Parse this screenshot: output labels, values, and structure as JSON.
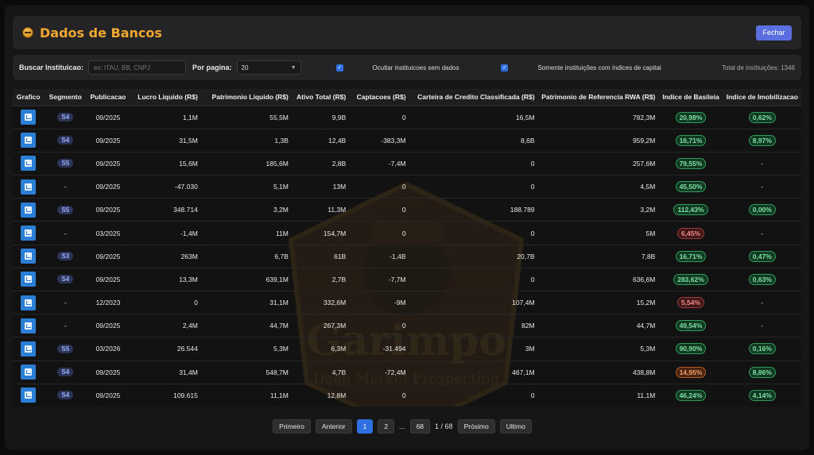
{
  "header": {
    "title": "Dados de Bancos",
    "close_label": "Fechar"
  },
  "filters": {
    "search_label": "Buscar Instituicao:",
    "search_placeholder": "ex: ITAU, BB, CNPJ",
    "per_page_label": "Por pagina:",
    "per_page_value": "20",
    "hide_no_data_label": "Ocultar instituicoes sem dados",
    "hide_no_data_checked": true,
    "only_capital_label": "Somente instituições com índices de capital",
    "only_capital_checked": true,
    "total_label": "Total de instituições: 1346"
  },
  "table": {
    "columns": [
      "Grafico",
      "Segmento",
      "Publicacao",
      "Lucro Liquido (R$)",
      "Patrimonio Liquido (R$)",
      "Ativo Total (R$)",
      "Captacoes (R$)",
      "Carteira de Credito Classificada (R$)",
      "Patrimonio de Referencia RWA (R$)",
      "Indice de Basileia",
      "Indice de Imobilizacao"
    ],
    "rows": [
      {
        "segmento": "S4",
        "publicacao": "09/2025",
        "lucro": "1,1M",
        "patrimonio": "55,5M",
        "ativo": "9,9B",
        "captacoes": "0",
        "carteira": "16,5M",
        "pr_rwa": "782,3M",
        "basileia": "20,98%",
        "basileia_status": "green",
        "imobilizacao": "0,62%"
      },
      {
        "segmento": "S4",
        "publicacao": "09/2025",
        "lucro": "31,5M",
        "patrimonio": "1,3B",
        "ativo": "12,4B",
        "captacoes": "-383,3M",
        "carteira": "8,6B",
        "pr_rwa": "959,2M",
        "basileia": "16,71%",
        "basileia_status": "green",
        "imobilizacao": "8,97%"
      },
      {
        "segmento": "S5",
        "publicacao": "09/2025",
        "lucro": "15,6M",
        "patrimonio": "185,6M",
        "ativo": "2,8B",
        "captacoes": "-7,4M",
        "carteira": "0",
        "pr_rwa": "257,6M",
        "basileia": "79,55%",
        "basileia_status": "green",
        "imobilizacao": "-"
      },
      {
        "segmento": "-",
        "publicacao": "09/2025",
        "lucro": "-47.030",
        "patrimonio": "5,1M",
        "ativo": "13M",
        "captacoes": "0",
        "carteira": "0",
        "pr_rwa": "4,5M",
        "basileia": "45,50%",
        "basileia_status": "green",
        "imobilizacao": "-"
      },
      {
        "segmento": "S5",
        "publicacao": "09/2025",
        "lucro": "348.714",
        "patrimonio": "3,2M",
        "ativo": "11,3M",
        "captacoes": "0",
        "carteira": "188.789",
        "pr_rwa": "3,2M",
        "basileia": "112,43%",
        "basileia_status": "green",
        "imobilizacao": "0,00%"
      },
      {
        "segmento": "-",
        "publicacao": "03/2025",
        "lucro": "-1,4M",
        "patrimonio": "11M",
        "ativo": "154,7M",
        "captacoes": "0",
        "carteira": "0",
        "pr_rwa": "5M",
        "basileia": "6,45%",
        "basileia_status": "red",
        "imobilizacao": "-"
      },
      {
        "segmento": "S3",
        "publicacao": "09/2025",
        "lucro": "263M",
        "patrimonio": "6,7B",
        "ativo": "61B",
        "captacoes": "-1,4B",
        "carteira": "20,7B",
        "pr_rwa": "7,8B",
        "basileia": "16,71%",
        "basileia_status": "green",
        "imobilizacao": "0,47%"
      },
      {
        "segmento": "S4",
        "publicacao": "09/2025",
        "lucro": "13,3M",
        "patrimonio": "639,1M",
        "ativo": "2,7B",
        "captacoes": "-7,7M",
        "carteira": "0",
        "pr_rwa": "636,6M",
        "basileia": "283,62%",
        "basileia_status": "green",
        "imobilizacao": "0,63%"
      },
      {
        "segmento": "-",
        "publicacao": "12/2023",
        "lucro": "0",
        "patrimonio": "31,1M",
        "ativo": "332,6M",
        "captacoes": "-9M",
        "carteira": "107,4M",
        "pr_rwa": "15,2M",
        "basileia": "5,54%",
        "basileia_status": "red",
        "imobilizacao": "-"
      },
      {
        "segmento": "-",
        "publicacao": "09/2025",
        "lucro": "2,4M",
        "patrimonio": "44,7M",
        "ativo": "267,3M",
        "captacoes": "0",
        "carteira": "82M",
        "pr_rwa": "44,7M",
        "basileia": "49,54%",
        "basileia_status": "green",
        "imobilizacao": "-"
      },
      {
        "segmento": "S5",
        "publicacao": "03/2026",
        "lucro": "26.544",
        "patrimonio": "5,3M",
        "ativo": "6,3M",
        "captacoes": "-31.494",
        "carteira": "3M",
        "pr_rwa": "5,3M",
        "basileia": "90,90%",
        "basileia_status": "green",
        "imobilizacao": "0,16%"
      },
      {
        "segmento": "S4",
        "publicacao": "09/2025",
        "lucro": "31,4M",
        "patrimonio": "548,7M",
        "ativo": "4,7B",
        "captacoes": "-72,4M",
        "carteira": "467,1M",
        "pr_rwa": "438,8M",
        "basileia": "14,95%",
        "basileia_status": "orange",
        "imobilizacao": "8,86%"
      },
      {
        "segmento": "S4",
        "publicacao": "09/2025",
        "lucro": "109.615",
        "patrimonio": "11,1M",
        "ativo": "12,8M",
        "captacoes": "0",
        "carteira": "0",
        "pr_rwa": "11,1M",
        "basileia": "46,24%",
        "basileia_status": "green",
        "imobilizacao": "4,14%"
      }
    ]
  },
  "watermark": {
    "brand": "Garimpo",
    "tagline": "Deep Market Prospecting"
  },
  "pagination": {
    "first_label": "Primeiro",
    "prev_label": "Anterior",
    "pages": [
      "1",
      "2"
    ],
    "ellipsis": "...",
    "last_page": "68",
    "page_info": "1 / 68",
    "next_label": "Próximo",
    "last_label": "Ultimo",
    "current_page": 1
  },
  "colors": {
    "accent": "#f0a830",
    "primary_button": "#5b6ee0",
    "active_page": "#2f6fe0",
    "chart_button": "#2b7fd6"
  },
  "icons": {
    "logo": "gold-nugget-icon",
    "chart": "chart-icon",
    "select": "chevron-down-icon",
    "checkbox": "checkmark-icon"
  }
}
